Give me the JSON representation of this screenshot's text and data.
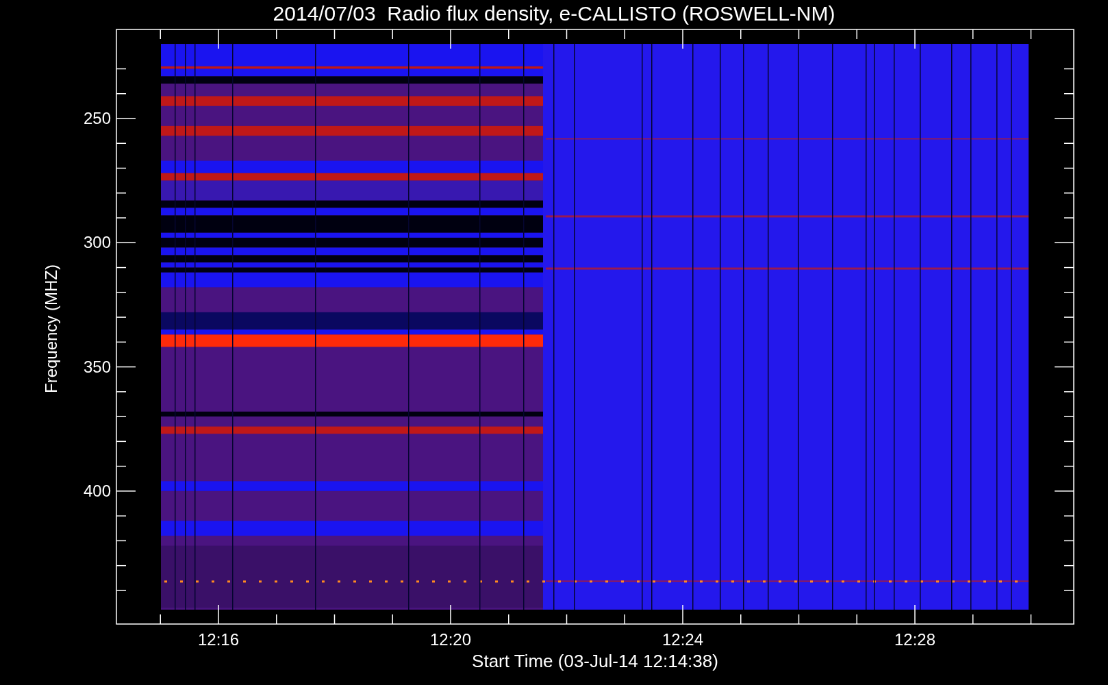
{
  "title": "2014/07/03  Radio flux density, e-CALLISTO (ROSWELL-NM)",
  "y_axis": {
    "label": "Frequency (MHZ)",
    "ticks": [
      "250",
      "300",
      "350",
      "400"
    ]
  },
  "x_axis": {
    "label": "Start Time (03-Jul-14 12:14:38)",
    "ticks": [
      "12:16",
      "12:20",
      "12:24",
      "12:28"
    ]
  }
}
